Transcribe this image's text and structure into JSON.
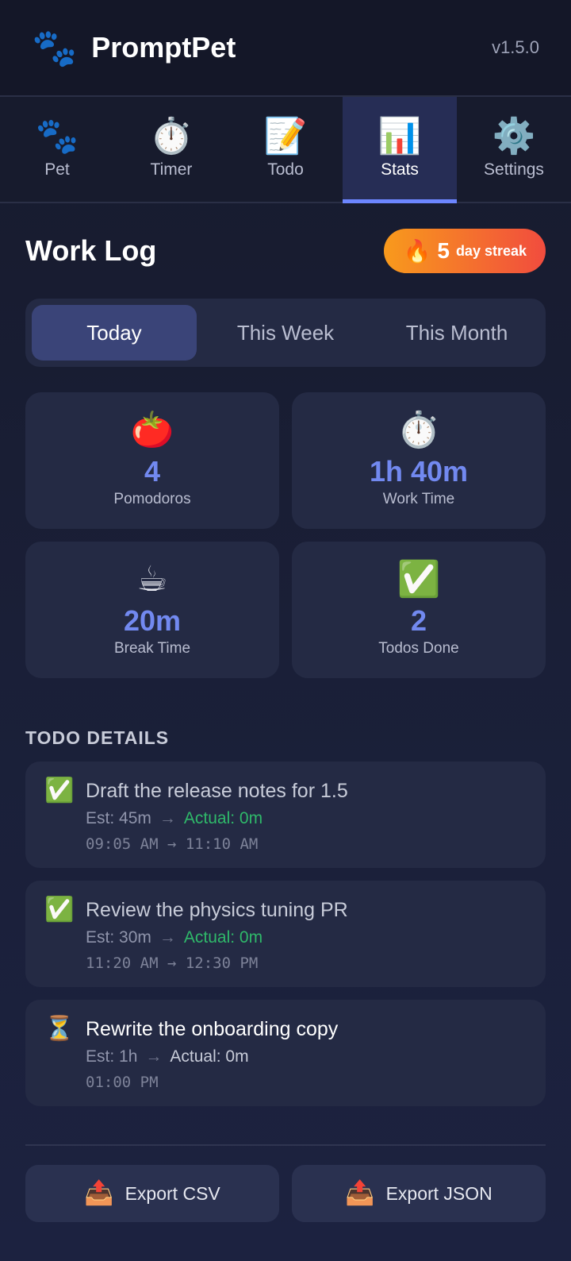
{
  "header": {
    "app_name": "PromptPet",
    "version": "v1.5.0",
    "logo_icon": "🐾"
  },
  "tabs": [
    {
      "icon": "🐾",
      "label": "Pet"
    },
    {
      "icon": "⏱️",
      "label": "Timer"
    },
    {
      "icon": "📝",
      "label": "Todo"
    },
    {
      "icon": "📊",
      "label": "Stats",
      "active": true
    },
    {
      "icon": "⚙️",
      "label": "Settings"
    }
  ],
  "page": {
    "title": "Work Log",
    "streak": {
      "icon": "🔥",
      "count": "5",
      "label": "day streak"
    }
  },
  "range_tabs": [
    {
      "label": "Today",
      "active": true
    },
    {
      "label": "This Week"
    },
    {
      "label": "This Month"
    }
  ],
  "stats": [
    {
      "icon": "🍅",
      "value": "4",
      "label": "Pomodoros"
    },
    {
      "icon": "⏱️",
      "value": "1h 40m",
      "label": "Work Time"
    },
    {
      "icon": "☕",
      "value": "20m",
      "label": "Break Time"
    },
    {
      "icon": "✅",
      "value": "2",
      "label": "Todos Done"
    }
  ],
  "todo_section": {
    "title": "TODO DETAILS",
    "items": [
      {
        "status_icon": "✅",
        "title": "Draft the release notes for 1.5",
        "est": "Est: 45m",
        "arrow": "→",
        "actual": "Actual: 0m",
        "time": "09:05 AM → 11:10 AM"
      },
      {
        "status_icon": "✅",
        "title": "Review the physics tuning PR",
        "est": "Est: 30m",
        "arrow": "→",
        "actual": "Actual: 0m",
        "time": "11:20 AM → 12:30 PM"
      },
      {
        "status_icon": "⏳",
        "title": "Rewrite the onboarding copy",
        "est": "Est: 1h",
        "arrow": "→",
        "actual": "Actual: 0m",
        "time": "01:00 PM"
      }
    ]
  },
  "export": {
    "icon": "📤",
    "csv_label": "Export CSV",
    "json_label": "Export JSON"
  },
  "colors": {
    "accent": "#7289f0",
    "active_tab": "#262d55",
    "streak_start": "#f89a1c",
    "streak_end": "#f14c3e",
    "done_green": "#2fb96a"
  }
}
